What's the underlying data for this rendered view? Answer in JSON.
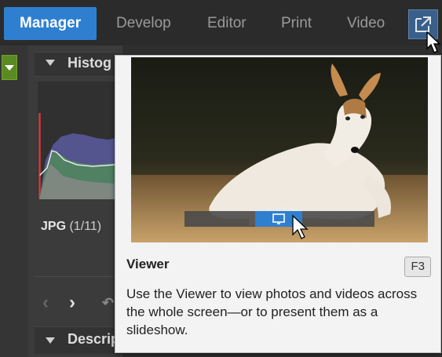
{
  "tabs": [
    {
      "label": "Manager",
      "active": true
    },
    {
      "label": "Develop",
      "active": false
    },
    {
      "label": "Editor",
      "active": false
    },
    {
      "label": "Print",
      "active": false
    },
    {
      "label": "Video",
      "active": false
    }
  ],
  "top_icon": "external-window-icon",
  "panel": {
    "histogram_title": "Histog",
    "file_format": "JPG",
    "file_position": "(1/11)",
    "description_title": "Descrip"
  },
  "tooltip": {
    "title": "Viewer",
    "shortcut": "F3",
    "description": "Use the Viewer to view photos and videos across the whole screen—or to present them as a slideshow."
  },
  "colors": {
    "accent": "#2f7fd0",
    "green": "#5a8a22",
    "tooltip_bg": "#f3f3f3"
  }
}
